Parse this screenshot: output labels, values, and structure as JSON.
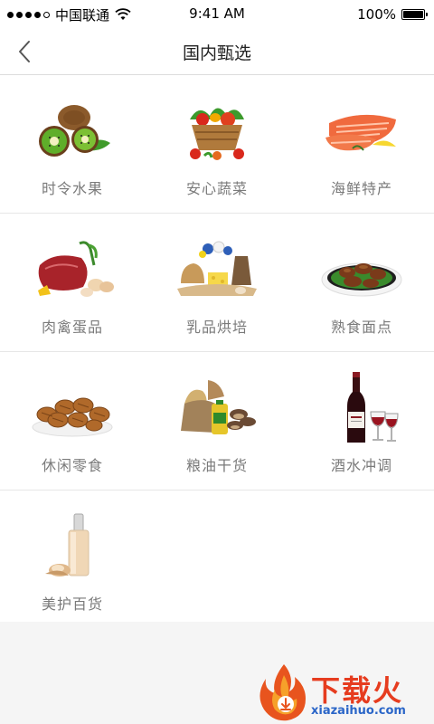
{
  "status_bar": {
    "carrier": "中国联通",
    "time": "9:41 AM",
    "battery": "100%",
    "signal_dots_filled": 4,
    "signal_dots_total": 5
  },
  "nav": {
    "title": "国内甄选",
    "back_icon": "chevron-left-icon"
  },
  "categories": [
    {
      "label": "时令水果",
      "icon": "kiwi-fruit-icon"
    },
    {
      "label": "安心蔬菜",
      "icon": "vegetable-basket-icon"
    },
    {
      "label": "海鲜特产",
      "icon": "salmon-icon"
    },
    {
      "label": "肉禽蛋品",
      "icon": "meat-eggs-icon"
    },
    {
      "label": "乳品烘培",
      "icon": "dairy-bakery-icon"
    },
    {
      "label": "熟食面点",
      "icon": "cooked-meat-icon"
    },
    {
      "label": "休闲零食",
      "icon": "nuts-snack-icon"
    },
    {
      "label": "粮油干货",
      "icon": "grain-oil-icon"
    },
    {
      "label": "酒水冲调",
      "icon": "wine-icon"
    },
    {
      "label": "美护百货",
      "icon": "cosmetics-bottle-icon"
    }
  ],
  "watermark": {
    "text": "下载火",
    "url": "xiazaihuo.com"
  },
  "colors": {
    "label": "#7a7a7a",
    "watermark_red": "#e63c1f",
    "watermark_blue": "#2b66c8"
  }
}
